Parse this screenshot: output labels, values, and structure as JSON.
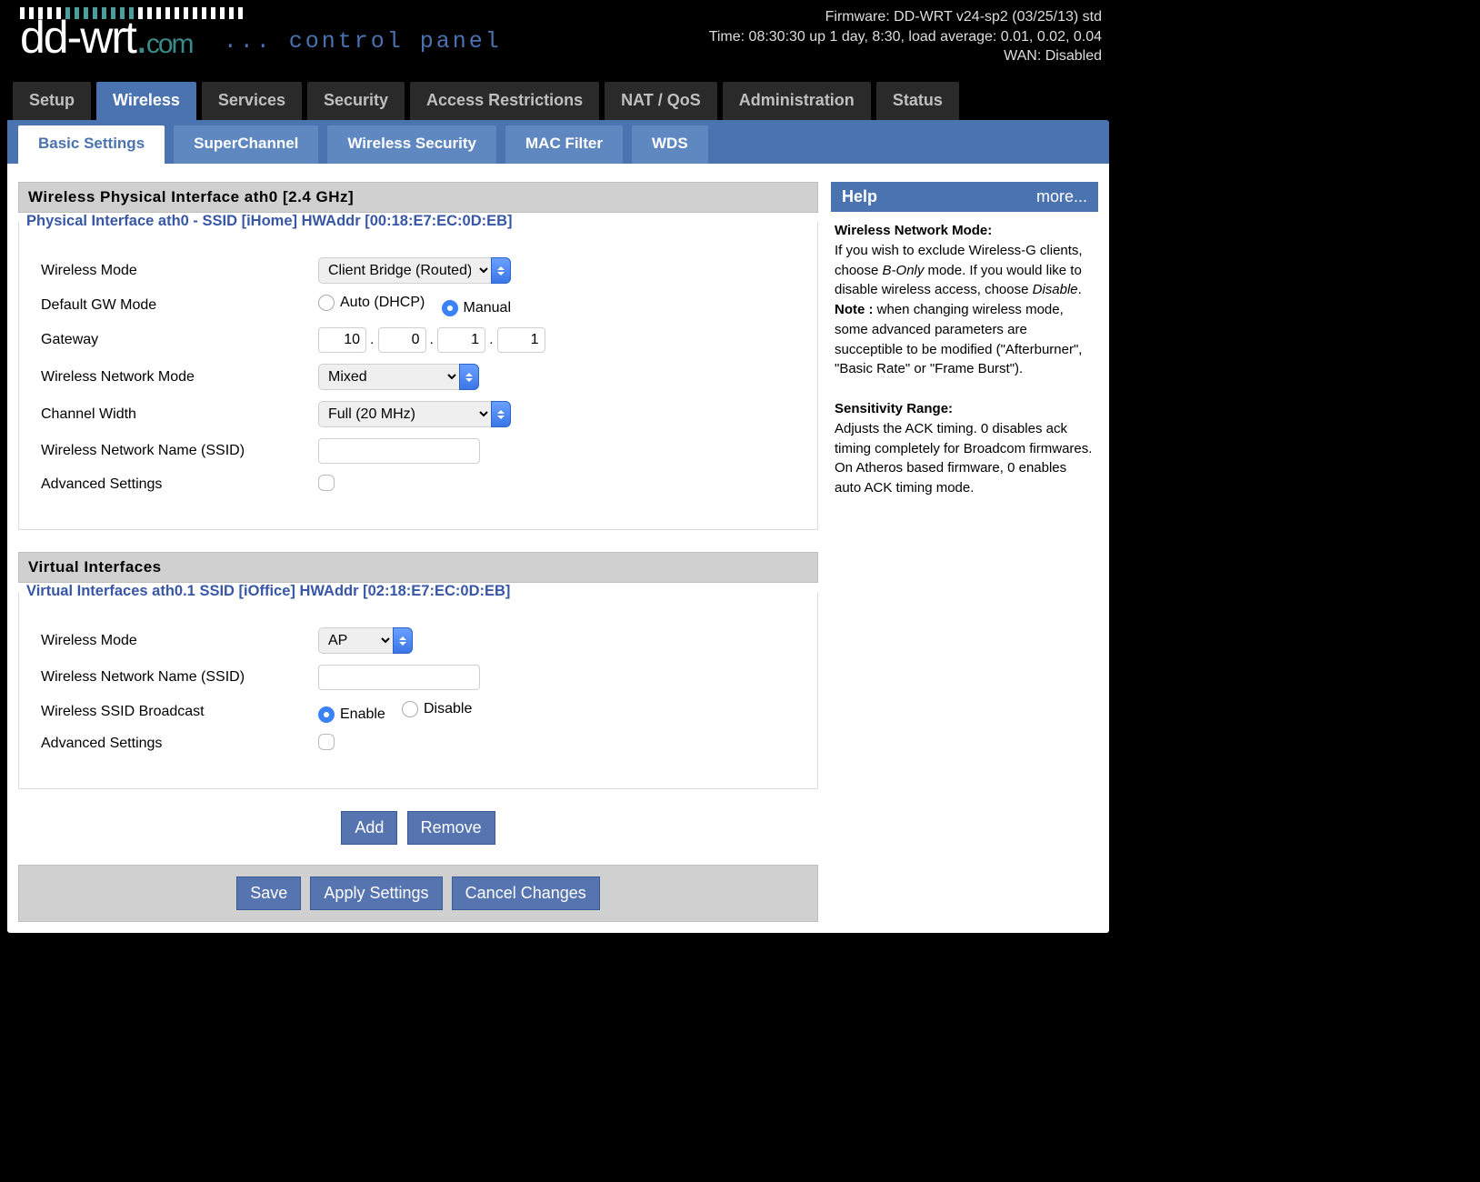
{
  "header": {
    "firmware": "Firmware: DD-WRT v24-sp2 (03/25/13) std",
    "time": "Time: 08:30:30 up 1 day, 8:30, load average: 0.01, 0.02, 0.04",
    "wan": "WAN: Disabled",
    "tagline": "... control panel"
  },
  "tabs": {
    "main": [
      "Setup",
      "Wireless",
      "Services",
      "Security",
      "Access Restrictions",
      "NAT / QoS",
      "Administration",
      "Status"
    ],
    "main_active": 1,
    "sub": [
      "Basic Settings",
      "SuperChannel",
      "Wireless Security",
      "MAC Filter",
      "WDS"
    ],
    "sub_active": 0
  },
  "section1": {
    "title": "Wireless Physical Interface ath0 [2.4 GHz]",
    "legend": "Physical Interface ath0 - SSID [iHome] HWAddr [00:18:E7:EC:0D:EB]",
    "wireless_mode_label": "Wireless Mode",
    "wireless_mode_value": "Client Bridge (Routed)",
    "gw_mode_label": "Default GW Mode",
    "gw_mode_opt1": "Auto (DHCP)",
    "gw_mode_opt2": "Manual",
    "gateway_label": "Gateway",
    "gateway": [
      "10",
      "0",
      "1",
      "1"
    ],
    "net_mode_label": "Wireless Network Mode",
    "net_mode_value": "Mixed",
    "chan_width_label": "Channel Width",
    "chan_width_value": "Full (20 MHz)",
    "ssid_label": "Wireless Network Name (SSID)",
    "ssid_value": "",
    "adv_label": "Advanced Settings"
  },
  "section2": {
    "title": "Virtual Interfaces",
    "legend": "Virtual Interfaces ath0.1 SSID [iOffice] HWAddr [02:18:E7:EC:0D:EB]",
    "wireless_mode_label": "Wireless Mode",
    "wireless_mode_value": "AP",
    "ssid_label": "Wireless Network Name (SSID)",
    "ssid_value": "",
    "bcast_label": "Wireless SSID Broadcast",
    "bcast_opt1": "Enable",
    "bcast_opt2": "Disable",
    "adv_label": "Advanced Settings"
  },
  "buttons": {
    "add": "Add",
    "remove": "Remove",
    "save": "Save",
    "apply": "Apply Settings",
    "cancel": "Cancel Changes"
  },
  "help": {
    "title": "Help",
    "more": "more...",
    "h1": "Wireless Network Mode:",
    "p1a": "If you wish to exclude Wireless-G clients, choose ",
    "p1b": "B-Only",
    "p1c": " mode. If you would like to disable wireless access, choose ",
    "p1d": "Disable",
    "p1e": ".",
    "note_label": "Note :",
    "note_text": " when changing wireless mode, some advanced parameters are succeptible to be modified (\"Afterburner\", \"Basic Rate\" or \"Frame Burst\").",
    "h2": "Sensitivity Range:",
    "p2": "Adjusts the ACK timing. 0 disables ack timing completely for Broadcom firmwares. On Atheros based firmware, 0 enables auto ACK timing mode."
  }
}
